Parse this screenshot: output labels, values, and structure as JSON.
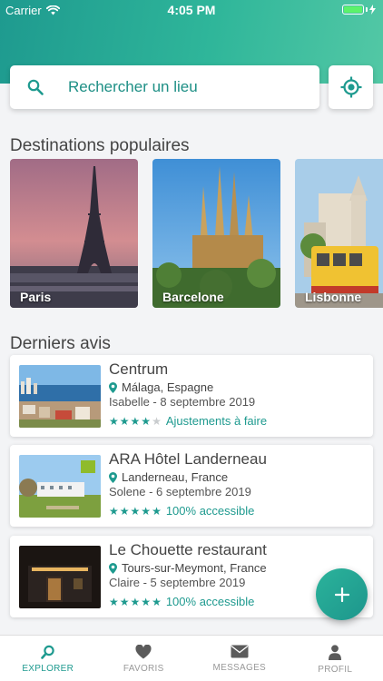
{
  "status_bar": {
    "carrier": "Carrier",
    "time": "4:05 PM"
  },
  "search": {
    "placeholder": "Rechercher un lieu"
  },
  "sections": {
    "popular_title": "Destinations populaires",
    "reviews_title": "Derniers avis"
  },
  "destinations": [
    {
      "name": "Paris"
    },
    {
      "name": "Barcelone"
    },
    {
      "name": "Lisbonne"
    }
  ],
  "reviews": [
    {
      "name": "Centrum",
      "location": "Málaga, Espagne",
      "author_date": "Isabelle - 8 septembre 2019",
      "stars": 4,
      "rating_label": "Ajustements à faire"
    },
    {
      "name": "ARA Hôtel Landerneau",
      "location": "Landerneau, France",
      "author_date": "Solene - 6 septembre 2019",
      "stars": 5,
      "rating_label": "100% accessible"
    },
    {
      "name": "Le Chouette restaurant",
      "location": "Tours-sur-Meymont, France",
      "author_date": "Claire - 5 septembre 2019",
      "stars": 5,
      "rating_label": "100% accessible"
    }
  ],
  "tabs": [
    {
      "label": "EXPLORER",
      "icon": "search-icon",
      "active": true
    },
    {
      "label": "FAVORIS",
      "icon": "heart-icon",
      "active": false
    },
    {
      "label": "MESSAGES",
      "icon": "mail-icon",
      "active": false
    },
    {
      "label": "PROFIL",
      "icon": "user-icon",
      "active": false
    }
  ],
  "colors": {
    "accent": "#1e9a8f",
    "star_filled": "#1e9a8f",
    "star_empty": "#c9ccce",
    "battery": "#5cf26b"
  }
}
